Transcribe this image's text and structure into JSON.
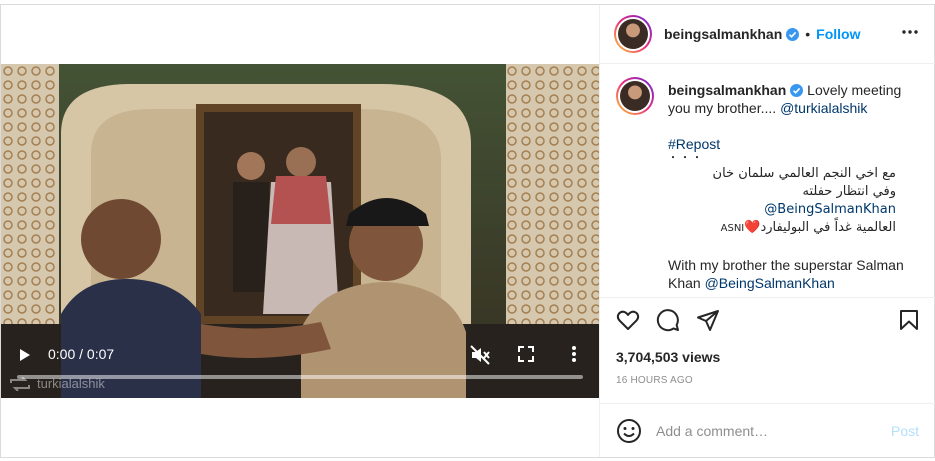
{
  "post": {
    "username": "beingsalmankhan",
    "separator": "•",
    "follow_label": "Follow"
  },
  "video": {
    "time": "0:00 / 0:07",
    "progress_fraction": 0.0,
    "watermark": "turkialalshik"
  },
  "caption": {
    "username": "beingsalmankhan",
    "line1": "Lovely meeting you my brother....",
    "mention1": "@turkialalshik",
    "hashtag": "#Repost",
    "dots": "・・・",
    "arabic1": "مع اخي النجم العالمي سلمان خان",
    "arabic2_text": "وفي انتظار حفلته",
    "arabic2_mention": "@BeingSalmanKhan",
    "arabic3_text": "العالمية غداً في البوليفارد",
    "arabic3_heart": "❤️",
    "arabic3_tag": "ASNI",
    "english_text": "With my brother the superstar Salman Khan",
    "english_mention": "@BeingSalmanKhan"
  },
  "stats": {
    "views": "3,704,503 views",
    "time_ago": "16 HOURS AGO"
  },
  "comment": {
    "placeholder": "Add a comment…",
    "post_label": "Post"
  },
  "icons": {
    "verified": "verified-badge-icon",
    "more": "more-horizontal-icon",
    "like": "heart-icon",
    "comment": "comment-bubble-icon",
    "share": "paper-plane-icon",
    "save": "bookmark-icon",
    "emoji": "smiley-icon",
    "play": "play-icon",
    "mute": "speaker-muted-icon",
    "fullscreen": "fullscreen-icon",
    "video_more": "more-vertical-icon",
    "repost": "repost-icon"
  },
  "colors": {
    "accent": "#0095f6",
    "link": "#00376b",
    "verified": "#3897f0",
    "post_disabled": "#b2dffc"
  }
}
